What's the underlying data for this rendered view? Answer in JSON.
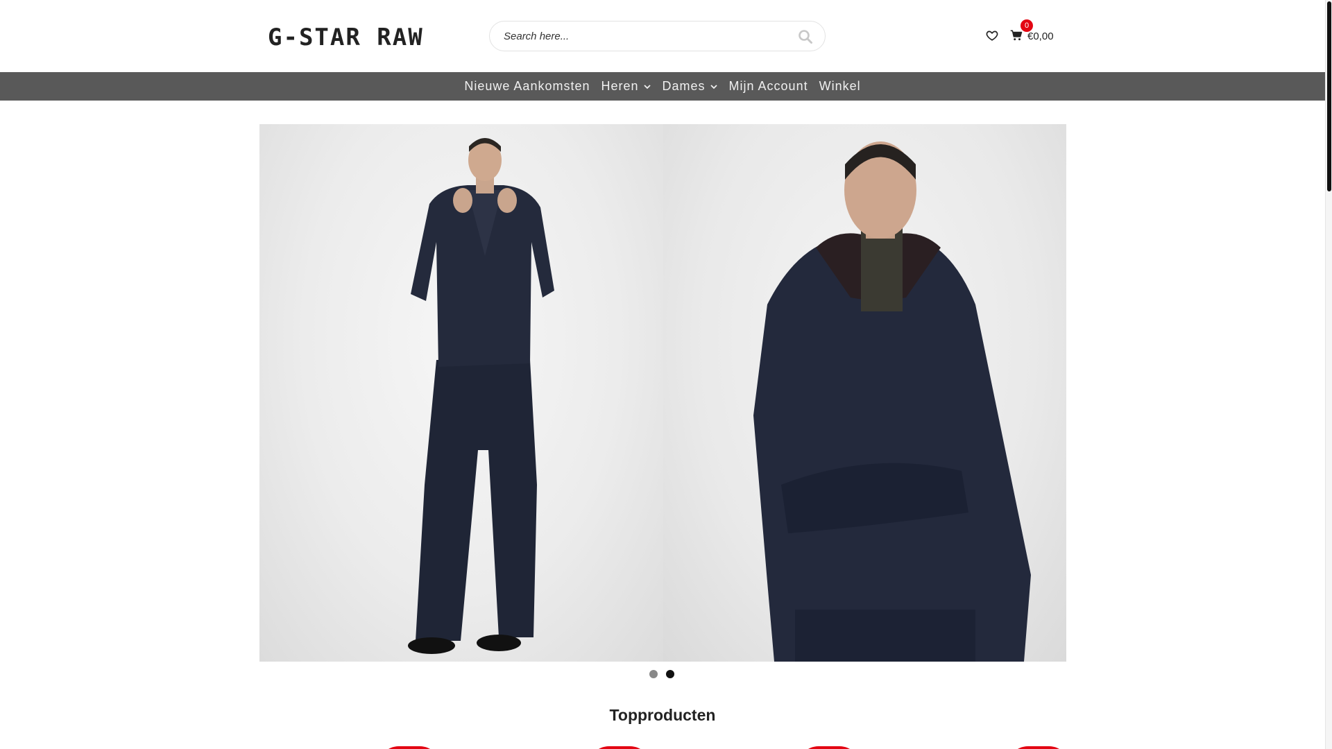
{
  "header": {
    "logo_text": "G-STAR RAW",
    "search": {
      "placeholder": "Search here...",
      "value": ""
    },
    "search_icon": "search-icon",
    "wishlist_icon": "heart-icon",
    "cart_icon": "cart-icon",
    "cart_count": "0",
    "cart_total": "€0,00"
  },
  "nav": {
    "items": [
      {
        "label": "Nieuwe Aankomsten",
        "has_dropdown": false
      },
      {
        "label": "Heren",
        "has_dropdown": true
      },
      {
        "label": "Dames",
        "has_dropdown": true
      },
      {
        "label": "Mijn Account",
        "has_dropdown": false
      },
      {
        "label": "Winkel",
        "has_dropdown": false
      }
    ]
  },
  "slider": {
    "slides_count": 2,
    "active_index": 1
  },
  "section": {
    "title": "Topproducten"
  },
  "colors": {
    "nav_bg": "#595959",
    "accent": "#e30613",
    "denim": "#1f2536"
  }
}
